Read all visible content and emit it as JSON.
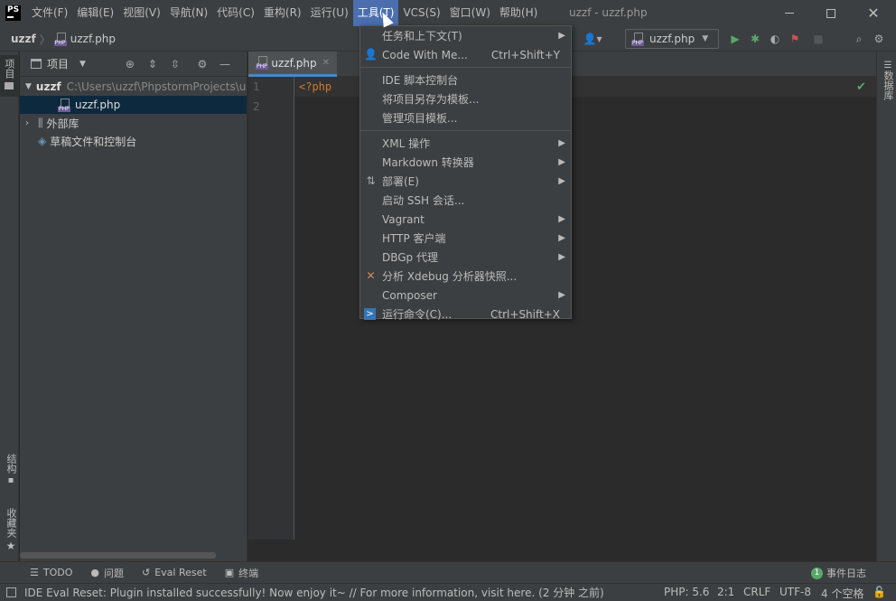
{
  "titlebar": {
    "logo": "PS",
    "window_title": "uzzf - uzzf.php",
    "menus": [
      "文件(F)",
      "编辑(E)",
      "视图(V)",
      "导航(N)",
      "代码(C)",
      "重构(R)",
      "运行(U)",
      "工具(T)",
      "VCS(S)",
      "窗口(W)",
      "帮助(H)"
    ]
  },
  "navbar": {
    "project": "uzzf",
    "file": "uzzf.php",
    "run_config": "uzzf.php"
  },
  "left_stripe": {
    "project_tab": "项目",
    "structure_tab": "结构",
    "favorites_tab": "收藏夹"
  },
  "right_stripe": {
    "database_tab": "数据库"
  },
  "project_panel": {
    "title": "项目",
    "tree": [
      {
        "label": "uzzf",
        "path": "C:\\Users\\uzzf\\PhpstormProjects\\uzzf"
      },
      {
        "label": "uzzf.php"
      },
      {
        "label": "外部库"
      },
      {
        "label": "草稿文件和控制台"
      }
    ]
  },
  "editor": {
    "tab": "uzzf.php",
    "lines": [
      "<?php",
      ""
    ],
    "line_numbers": [
      "1",
      "2"
    ]
  },
  "tools_menu": {
    "items": [
      {
        "label": "任务和上下文(T)",
        "submenu": true
      },
      {
        "label": "Code With Me...",
        "shortcut": "Ctrl+Shift+Y",
        "icon": "user-icon"
      },
      {
        "label": "IDE 脚本控制台"
      },
      {
        "label": "将项目另存为模板..."
      },
      {
        "label": "管理项目模板..."
      },
      {
        "label": "XML 操作",
        "submenu": true
      },
      {
        "label": "Markdown 转换器",
        "submenu": true
      },
      {
        "label": "部署(E)",
        "submenu": true,
        "icon": "deploy-icon"
      },
      {
        "label": "启动 SSH 会话..."
      },
      {
        "label": "Vagrant",
        "submenu": true
      },
      {
        "label": "HTTP 客户端",
        "submenu": true
      },
      {
        "label": "DBGp 代理",
        "submenu": true
      },
      {
        "label": "分析 Xdebug 分析器快照...",
        "icon": "xdebug-icon"
      },
      {
        "label": "Composer",
        "submenu": true
      },
      {
        "label": "运行命令(C)...",
        "shortcut": "Ctrl+Shift+X",
        "icon": "terminal-icon"
      }
    ]
  },
  "bottom_toolbar": {
    "todo": "TODO",
    "problems": "问题",
    "eval_reset": "Eval Reset",
    "terminal": "终端",
    "event_log": "事件日志",
    "event_count": "1"
  },
  "statusbar": {
    "message": "IDE Eval Reset: Plugin installed successfully! Now enjoy it~ // For more information, visit here. (2 分钟 之前)",
    "php": "PHP: 5.6",
    "position": "2:1",
    "line_sep": "CRLF",
    "encoding": "UTF-8",
    "indent": "4 个空格"
  },
  "colors": {
    "accent": "#4b6eaf",
    "selection": "#0d293e",
    "keyword": "#cc7832",
    "run": "#59a869"
  }
}
